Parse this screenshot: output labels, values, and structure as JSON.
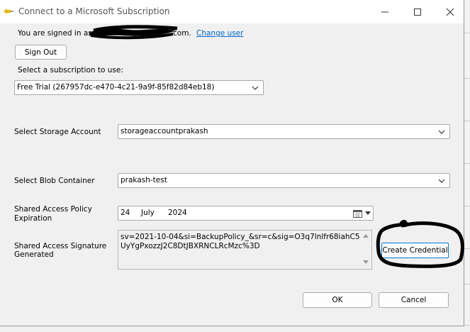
{
  "window": {
    "title": "Connect to a Microsoft Subscription"
  },
  "account": {
    "signed_in_prefix": "You are signed in as",
    "email_suffix": "com.",
    "change_user_link": "Change user",
    "sign_out_button": "Sign Out"
  },
  "subscription": {
    "label": "Select a subscription to use:",
    "selected": "Free Trial (267957dc-e470-4c21-9a9f-85f82d84eb18)"
  },
  "storage": {
    "label": "Select Storage Account",
    "selected": "storageaccountprakash"
  },
  "blob": {
    "label": "Select Blob Container",
    "selected": "prakash-test"
  },
  "expiration": {
    "label_line1": "Shared Access Policy",
    "label_line2": "Expiration",
    "day": "24",
    "month": "July",
    "year": "2024"
  },
  "signature": {
    "label_line1": "Shared Access Signature",
    "label_line2": "Generated",
    "value": "sv=2021-10-04&si=BackupPolicy_&sr=c&sig=O3q7lnlfr68iahC5UyYgPxozzJ2C8DtJBXRNCLRcMzc%3D",
    "create_button": "Create Credential"
  },
  "footer": {
    "ok_button": "OK",
    "cancel_button": "Cancel"
  },
  "icons": {
    "app": "connect-plug-icon",
    "minimize": "minimize-icon",
    "maximize": "maximize-icon",
    "close": "close-icon",
    "dropdown": "chevron-down-icon",
    "calendar": "calendar-icon"
  },
  "colors": {
    "link": "#0066cc",
    "dialog_bg": "#f0f0f0",
    "focus_border": "#0078d7"
  }
}
